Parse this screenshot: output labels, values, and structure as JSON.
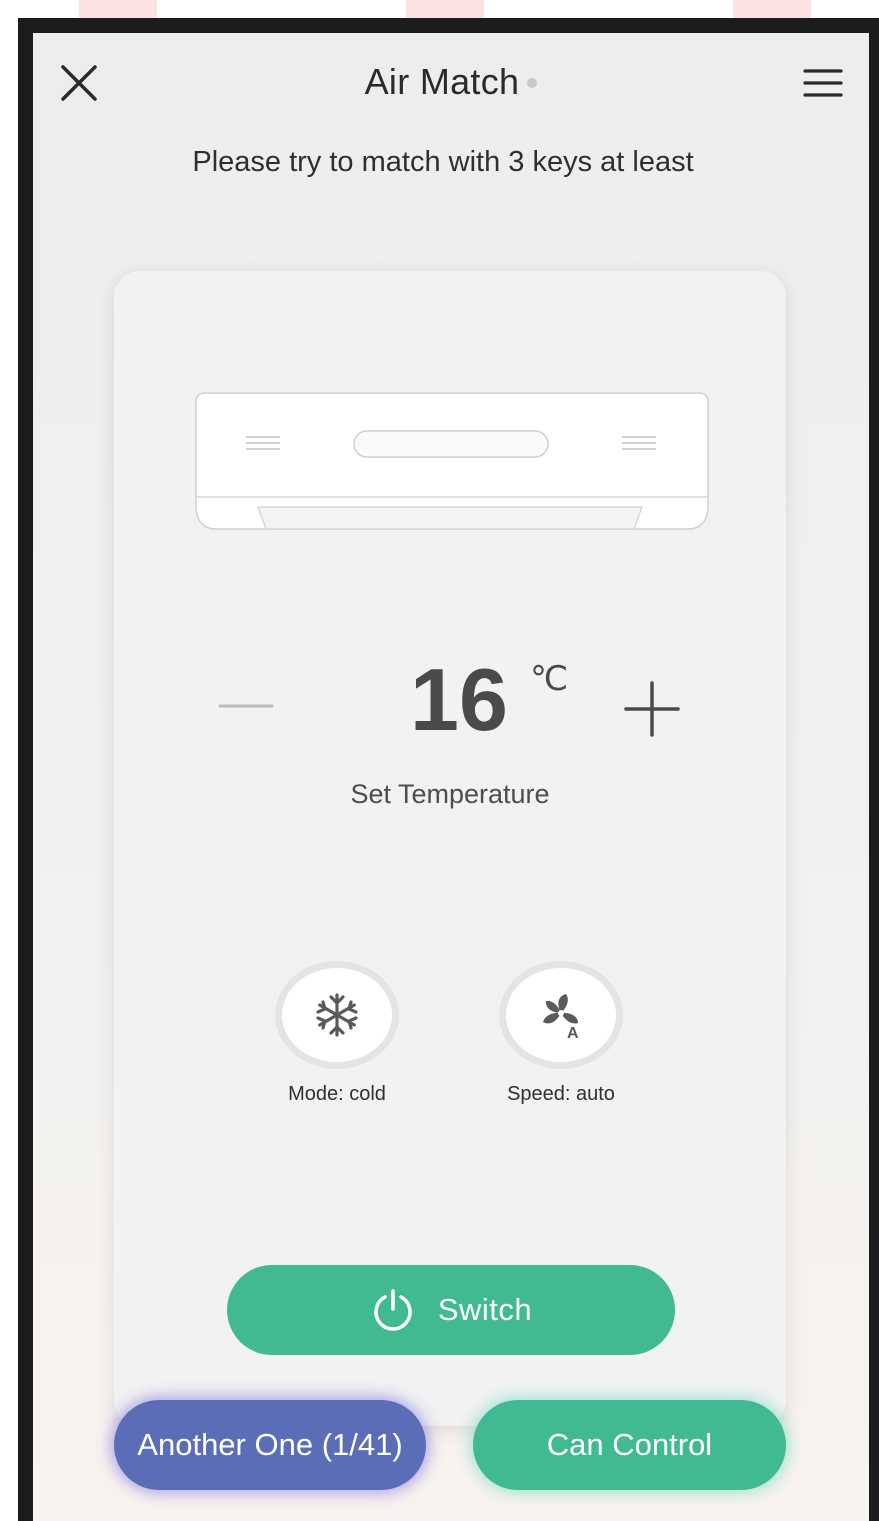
{
  "header": {
    "title": "Air Match",
    "close_icon": "close-icon",
    "menu_icon": "hamburger-menu-icon"
  },
  "instruction": "Please try to match with 3 keys at least",
  "remote": {
    "device_image": "air-conditioner-unit",
    "temperature": {
      "value": "16",
      "unit": "℃",
      "label": "Set Temperature",
      "decrease_icon": "minus-icon",
      "increase_icon": "plus-icon"
    },
    "mode": {
      "icon": "snowflake-icon",
      "label": "Mode: cold"
    },
    "speed": {
      "icon": "fan-auto-icon",
      "label": "Speed: auto"
    },
    "switch": {
      "icon": "power-icon",
      "label": "Switch"
    }
  },
  "footer": {
    "another_label": "Another One (1/41)",
    "control_label": "Can Control"
  },
  "colors": {
    "primary_green": "#41b993",
    "secondary_blue": "#5c6db7"
  }
}
